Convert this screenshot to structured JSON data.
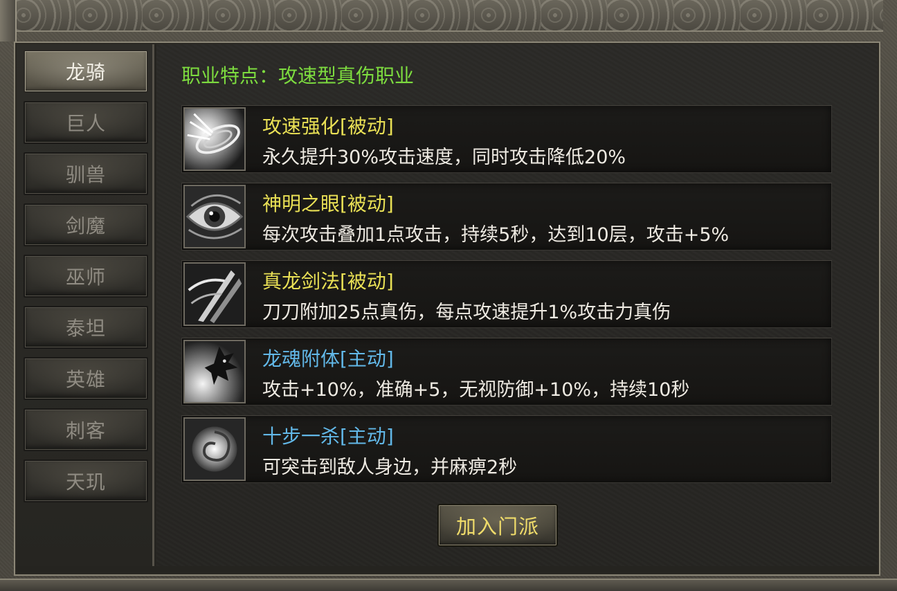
{
  "sidebar": {
    "tabs": [
      {
        "label": "龙骑",
        "selected": true
      },
      {
        "label": "巨人",
        "selected": false
      },
      {
        "label": "驯兽",
        "selected": false
      },
      {
        "label": "剑魔",
        "selected": false
      },
      {
        "label": "巫师",
        "selected": false
      },
      {
        "label": "泰坦",
        "selected": false
      },
      {
        "label": "英雄",
        "selected": false
      },
      {
        "label": "刺客",
        "selected": false
      },
      {
        "label": "天玑",
        "selected": false
      }
    ]
  },
  "main": {
    "feature_title": "职业特点：攻速型真伤职业",
    "skills": [
      {
        "name": "攻速强化[被动]",
        "type": "passive",
        "icon": "speed-burst-icon",
        "description": "永久提升30%攻击速度，同时攻击降低20%"
      },
      {
        "name": "神明之眼[被动]",
        "type": "passive",
        "icon": "eye-icon",
        "description": "每次攻击叠加1点攻击，持续5秒，达到10层，攻击+5%"
      },
      {
        "name": "真龙剑法[被动]",
        "type": "passive",
        "icon": "blades-icon",
        "description": "刀刀附加25点真伤，每点攻速提升1%攻击力真伤"
      },
      {
        "name": "龙魂附体[主动]",
        "type": "active",
        "icon": "dragon-soul-icon",
        "description": "攻击+10%，准确+5，无视防御+10%，持续10秒"
      },
      {
        "name": "十步一杀[主动]",
        "type": "active",
        "icon": "swirl-icon",
        "description": "可突击到敌人身边，并麻痹2秒"
      }
    ],
    "join_button": "加入门派"
  },
  "colors": {
    "feature_title": "#7ddc3f",
    "passive_skill": "#e9e055",
    "active_skill": "#62b8e8",
    "description": "#eeeae2",
    "button_text": "#f0dc6a"
  }
}
